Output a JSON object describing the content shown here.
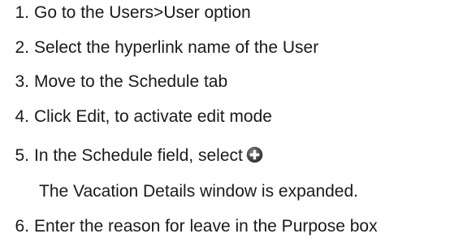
{
  "steps": [
    {
      "number": "1.",
      "text": "Go to the Users>User option"
    },
    {
      "number": "2.",
      "text": "Select the hyperlink name of the User"
    },
    {
      "number": "3.",
      "text": "Move to the Schedule tab"
    },
    {
      "number": "4.",
      "text": "Click Edit, to activate edit mode"
    },
    {
      "number": "5.",
      "text": "In the Schedule field, select",
      "icon": "plus-circle-icon"
    },
    {
      "number": "6.",
      "text": "Enter the reason for leave in the Purpose box"
    }
  ],
  "step5_note": "The Vacation Details window is expanded."
}
